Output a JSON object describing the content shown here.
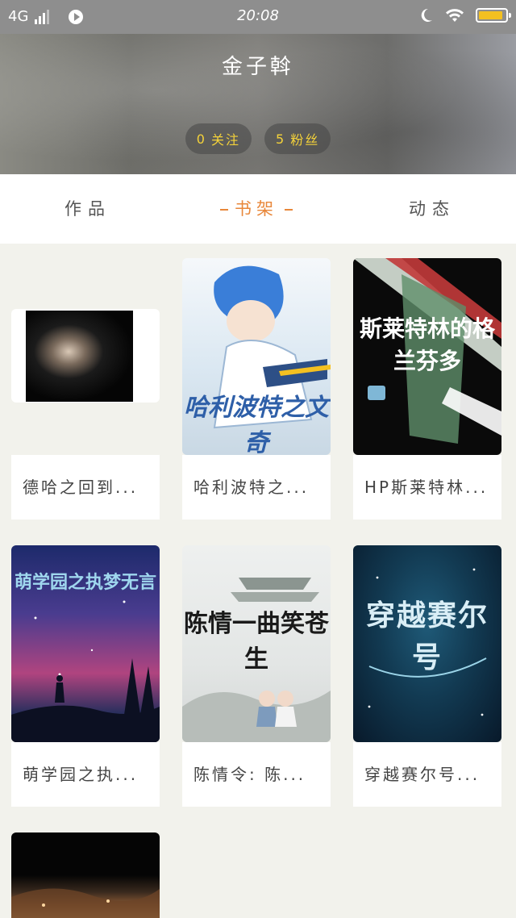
{
  "status_bar": {
    "network": "4G",
    "time": "20:08",
    "battery_level": 0.9,
    "battery_color": "#f3c021"
  },
  "profile": {
    "name": "金子斡",
    "following_count": "0",
    "following_label": "关注",
    "followers_count": "5",
    "followers_label": "粉丝"
  },
  "tabs": [
    {
      "label": "作品",
      "active": false
    },
    {
      "label": "书架",
      "active": true
    },
    {
      "label": "动态",
      "active": false
    }
  ],
  "accent_color": "#e8873a",
  "books": [
    {
      "title": "德哈之回到...",
      "cover_icon": "photo-icon"
    },
    {
      "title": "哈利波特之...",
      "cover_text": "哈利波特之文奇"
    },
    {
      "title": "HP斯莱特林...",
      "cover_text": "斯莱特林的格兰芬多"
    },
    {
      "title": "萌学园之执...",
      "cover_text": "萌学园之执梦无言"
    },
    {
      "title": "陈情令: 陈...",
      "cover_text": "陈情一曲笑苍生"
    },
    {
      "title": "穿越赛尔号...",
      "cover_text": "穿越赛尔号"
    },
    {
      "title": "",
      "cover_icon": "cover-image"
    }
  ]
}
